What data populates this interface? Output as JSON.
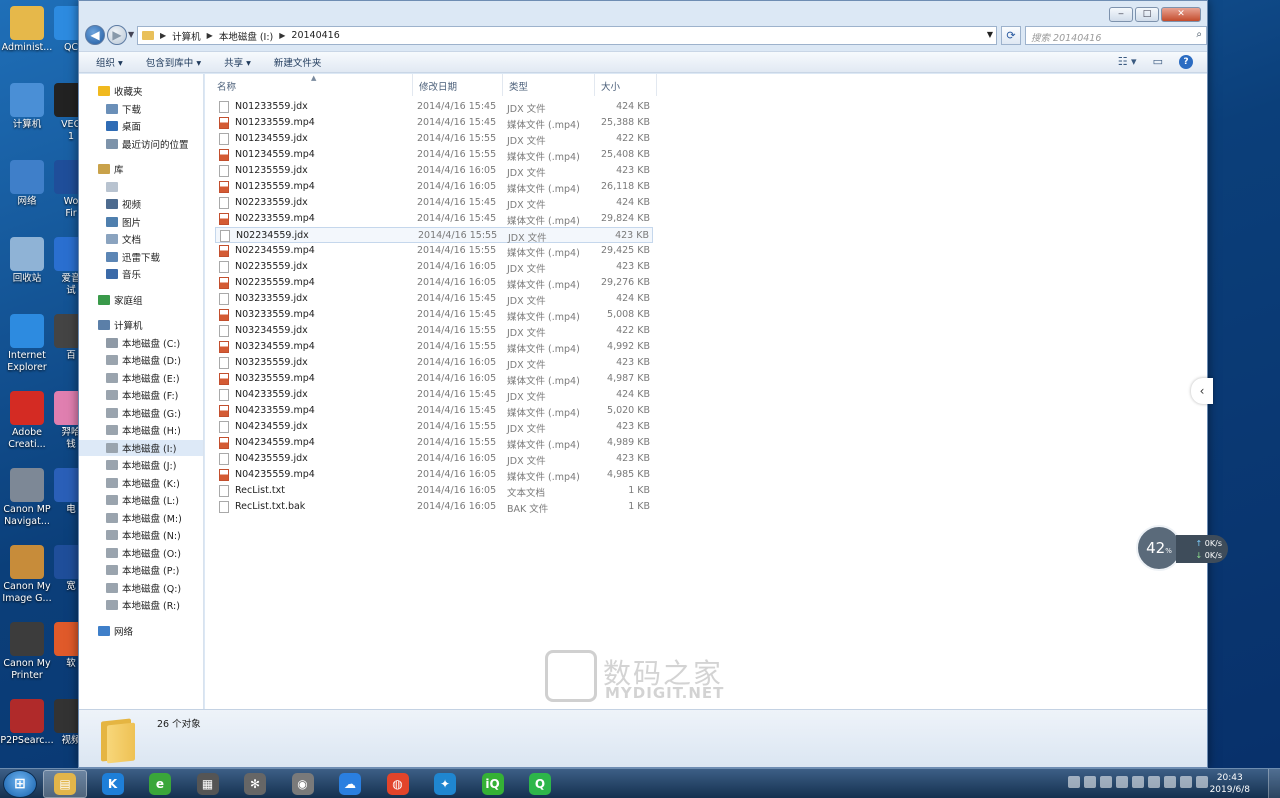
{
  "desktop": {
    "left_icons": [
      {
        "label": "Administ...",
        "icon": "user-folder-icon",
        "color": "#e6b84a"
      },
      {
        "label": "计算机",
        "icon": "computer-icon",
        "color": "#4a8fd6"
      },
      {
        "label": "网络",
        "icon": "network-icon",
        "color": "#3f7fc9"
      },
      {
        "label": "回收站",
        "icon": "recycle-bin-icon",
        "color": "#8fb3d6"
      },
      {
        "label": "Internet\nExplorer",
        "icon": "internet-explorer-icon",
        "color": "#2d8be0"
      },
      {
        "label": "Adobe\nCreati...",
        "icon": "adobe-creative-cloud-icon",
        "color": "#d42b23"
      },
      {
        "label": "Canon MP\nNavigat...",
        "icon": "canon-mp-navigator-icon",
        "color": "#7d8896"
      },
      {
        "label": "Canon My\nImage G...",
        "icon": "canon-my-image-garden-icon",
        "color": "#c78c3a"
      },
      {
        "label": "Canon My\nPrinter",
        "icon": "canon-my-printer-icon",
        "color": "#3c3c3c"
      },
      {
        "label": "P2PSearc...",
        "icon": "p2psearcher-icon",
        "color": "#b02a2a"
      }
    ],
    "right_icons": [
      {
        "label": "QC",
        "icon": "qq-icon",
        "color": "#2d8be0"
      },
      {
        "label": "VEG\n1",
        "icon": "vegas-icon",
        "color": "#222222"
      },
      {
        "label": "Wo\nFir",
        "icon": "word-firefox-icon",
        "color": "#1f4e9a"
      },
      {
        "label": "爱音\n试",
        "icon": "music-app-icon",
        "color": "#2a6fd0"
      },
      {
        "label": "百",
        "icon": "baidu-icon",
        "color": "#444444"
      },
      {
        "label": "羿哈\n钱",
        "icon": "app-icon",
        "color": "#e07fb0"
      },
      {
        "label": "电",
        "icon": "app-icon",
        "color": "#2a5fb8"
      },
      {
        "label": "宽",
        "icon": "broadband-icon",
        "color": "#1f4e9a"
      },
      {
        "label": "软",
        "icon": "software-icon",
        "color": "#e05a2a"
      },
      {
        "label": "视频",
        "icon": "video-app-icon",
        "color": "#333333"
      }
    ]
  },
  "window": {
    "controls": {
      "minimize": "‒",
      "maximize": "□",
      "close": "✕"
    },
    "address": {
      "segments": [
        "计算机",
        "本地磁盘 (I:)",
        "20140416"
      ]
    },
    "search_placeholder": "搜索 20140416",
    "toolbar": {
      "organize": "组织 ▾",
      "include_library": "包含到库中 ▾",
      "share": "共享 ▾",
      "new_folder": "新建文件夹"
    }
  },
  "navpane": [
    {
      "label": "收藏夹",
      "icon": "star-icon",
      "color": "#f0b91f",
      "level": 0,
      "sel": false
    },
    {
      "label": "下载",
      "icon": "download-folder-icon",
      "color": "#6a8fb8",
      "level": 1,
      "sel": false
    },
    {
      "label": "桌面",
      "icon": "desktop-icon",
      "color": "#2f6cb5",
      "level": 1,
      "sel": false
    },
    {
      "label": "最近访问的位置",
      "icon": "recent-places-icon",
      "color": "#7d93aa",
      "level": 1,
      "sel": false
    },
    {
      "label": "",
      "icon": "spacer",
      "color": "",
      "level": 0,
      "sel": false
    },
    {
      "label": "库",
      "icon": "library-icon",
      "color": "#c9a24a",
      "level": 0,
      "sel": false
    },
    {
      "label": "",
      "icon": "library-folder-icon",
      "color": "#b8c3d0",
      "level": 1,
      "sel": false
    },
    {
      "label": "视频",
      "icon": "videos-icon",
      "color": "#4d6b8f",
      "level": 1,
      "sel": false
    },
    {
      "label": "图片",
      "icon": "pictures-icon",
      "color": "#4f7fae",
      "level": 1,
      "sel": false
    },
    {
      "label": "文档",
      "icon": "documents-icon",
      "color": "#8aa3bf",
      "level": 1,
      "sel": false
    },
    {
      "label": "迅雷下载",
      "icon": "thunder-download-icon",
      "color": "#5c86b5",
      "level": 1,
      "sel": false
    },
    {
      "label": "音乐",
      "icon": "music-icon",
      "color": "#3b6aa8",
      "level": 1,
      "sel": false
    },
    {
      "label": "",
      "icon": "spacer",
      "color": "",
      "level": 0,
      "sel": false
    },
    {
      "label": "家庭组",
      "icon": "homegroup-icon",
      "color": "#3a9a4a",
      "level": 0,
      "sel": false
    },
    {
      "label": "",
      "icon": "spacer",
      "color": "",
      "level": 0,
      "sel": false
    },
    {
      "label": "计算机",
      "icon": "computer-icon",
      "color": "#5b7fa8",
      "level": 0,
      "sel": false
    },
    {
      "label": "本地磁盘 (C:)",
      "icon": "system-drive-icon",
      "color": "#8f9aa6",
      "level": 1,
      "sel": false
    },
    {
      "label": "本地磁盘 (D:)",
      "icon": "drive-icon",
      "color": "#9aa4ae",
      "level": 1,
      "sel": false
    },
    {
      "label": "本地磁盘 (E:)",
      "icon": "drive-icon",
      "color": "#9aa4ae",
      "level": 1,
      "sel": false
    },
    {
      "label": "本地磁盘 (F:)",
      "icon": "drive-icon",
      "color": "#9aa4ae",
      "level": 1,
      "sel": false
    },
    {
      "label": "本地磁盘 (G:)",
      "icon": "drive-icon",
      "color": "#9aa4ae",
      "level": 1,
      "sel": false
    },
    {
      "label": "本地磁盘 (H:)",
      "icon": "drive-icon",
      "color": "#9aa4ae",
      "level": 1,
      "sel": false
    },
    {
      "label": "本地磁盘 (I:)",
      "icon": "drive-icon",
      "color": "#9aa4ae",
      "level": 1,
      "sel": true
    },
    {
      "label": "本地磁盘 (J:)",
      "icon": "drive-icon",
      "color": "#9aa4ae",
      "level": 1,
      "sel": false
    },
    {
      "label": "本地磁盘 (K:)",
      "icon": "drive-icon",
      "color": "#9aa4ae",
      "level": 1,
      "sel": false
    },
    {
      "label": "本地磁盘 (L:)",
      "icon": "drive-icon",
      "color": "#9aa4ae",
      "level": 1,
      "sel": false
    },
    {
      "label": "本地磁盘 (M:)",
      "icon": "drive-icon",
      "color": "#9aa4ae",
      "level": 1,
      "sel": false
    },
    {
      "label": "本地磁盘 (N:)",
      "icon": "drive-icon",
      "color": "#9aa4ae",
      "level": 1,
      "sel": false
    },
    {
      "label": "本地磁盘 (O:)",
      "icon": "drive-icon",
      "color": "#9aa4ae",
      "level": 1,
      "sel": false
    },
    {
      "label": "本地磁盘 (P:)",
      "icon": "drive-icon",
      "color": "#9aa4ae",
      "level": 1,
      "sel": false
    },
    {
      "label": "本地磁盘 (Q:)",
      "icon": "drive-icon",
      "color": "#9aa4ae",
      "level": 1,
      "sel": false
    },
    {
      "label": "本地磁盘 (R:)",
      "icon": "drive-icon",
      "color": "#9aa4ae",
      "level": 1,
      "sel": false
    },
    {
      "label": "",
      "icon": "spacer",
      "color": "",
      "level": 0,
      "sel": false
    },
    {
      "label": "网络",
      "icon": "network-icon",
      "color": "#3f7fc9",
      "level": 0,
      "sel": false
    }
  ],
  "columns": {
    "name": "名称",
    "date": "修改日期",
    "type": "类型",
    "size": "大小"
  },
  "files": [
    {
      "name": "N01233559.jdx",
      "date": "2014/4/16 15:45",
      "type": "JDX 文件",
      "size": "424 KB",
      "kind": "doc"
    },
    {
      "name": "N01233559.mp4",
      "date": "2014/4/16 15:45",
      "type": "媒体文件 (.mp4)",
      "size": "25,388 KB",
      "kind": "mp4"
    },
    {
      "name": "N01234559.jdx",
      "date": "2014/4/16 15:55",
      "type": "JDX 文件",
      "size": "422 KB",
      "kind": "doc"
    },
    {
      "name": "N01234559.mp4",
      "date": "2014/4/16 15:55",
      "type": "媒体文件 (.mp4)",
      "size": "25,408 KB",
      "kind": "mp4"
    },
    {
      "name": "N01235559.jdx",
      "date": "2014/4/16 16:05",
      "type": "JDX 文件",
      "size": "423 KB",
      "kind": "doc"
    },
    {
      "name": "N01235559.mp4",
      "date": "2014/4/16 16:05",
      "type": "媒体文件 (.mp4)",
      "size": "26,118 KB",
      "kind": "mp4"
    },
    {
      "name": "N02233559.jdx",
      "date": "2014/4/16 15:45",
      "type": "JDX 文件",
      "size": "424 KB",
      "kind": "doc"
    },
    {
      "name": "N02233559.mp4",
      "date": "2014/4/16 15:45",
      "type": "媒体文件 (.mp4)",
      "size": "29,824 KB",
      "kind": "mp4"
    },
    {
      "name": "N02234559.jdx",
      "date": "2014/4/16 15:55",
      "type": "JDX 文件",
      "size": "423 KB",
      "kind": "doc",
      "hover": true
    },
    {
      "name": "N02234559.mp4",
      "date": "2014/4/16 15:55",
      "type": "媒体文件 (.mp4)",
      "size": "29,425 KB",
      "kind": "mp4"
    },
    {
      "name": "N02235559.jdx",
      "date": "2014/4/16 16:05",
      "type": "JDX 文件",
      "size": "423 KB",
      "kind": "doc"
    },
    {
      "name": "N02235559.mp4",
      "date": "2014/4/16 16:05",
      "type": "媒体文件 (.mp4)",
      "size": "29,276 KB",
      "kind": "mp4"
    },
    {
      "name": "N03233559.jdx",
      "date": "2014/4/16 15:45",
      "type": "JDX 文件",
      "size": "424 KB",
      "kind": "doc"
    },
    {
      "name": "N03233559.mp4",
      "date": "2014/4/16 15:45",
      "type": "媒体文件 (.mp4)",
      "size": "5,008 KB",
      "kind": "mp4"
    },
    {
      "name": "N03234559.jdx",
      "date": "2014/4/16 15:55",
      "type": "JDX 文件",
      "size": "422 KB",
      "kind": "doc"
    },
    {
      "name": "N03234559.mp4",
      "date": "2014/4/16 15:55",
      "type": "媒体文件 (.mp4)",
      "size": "4,992 KB",
      "kind": "mp4"
    },
    {
      "name": "N03235559.jdx",
      "date": "2014/4/16 16:05",
      "type": "JDX 文件",
      "size": "423 KB",
      "kind": "doc"
    },
    {
      "name": "N03235559.mp4",
      "date": "2014/4/16 16:05",
      "type": "媒体文件 (.mp4)",
      "size": "4,987 KB",
      "kind": "mp4"
    },
    {
      "name": "N04233559.jdx",
      "date": "2014/4/16 15:45",
      "type": "JDX 文件",
      "size": "424 KB",
      "kind": "doc"
    },
    {
      "name": "N04233559.mp4",
      "date": "2014/4/16 15:45",
      "type": "媒体文件 (.mp4)",
      "size": "5,020 KB",
      "kind": "mp4"
    },
    {
      "name": "N04234559.jdx",
      "date": "2014/4/16 15:55",
      "type": "JDX 文件",
      "size": "423 KB",
      "kind": "doc"
    },
    {
      "name": "N04234559.mp4",
      "date": "2014/4/16 15:55",
      "type": "媒体文件 (.mp4)",
      "size": "4,989 KB",
      "kind": "mp4"
    },
    {
      "name": "N04235559.jdx",
      "date": "2014/4/16 16:05",
      "type": "JDX 文件",
      "size": "423 KB",
      "kind": "doc"
    },
    {
      "name": "N04235559.mp4",
      "date": "2014/4/16 16:05",
      "type": "媒体文件 (.mp4)",
      "size": "4,985 KB",
      "kind": "mp4"
    },
    {
      "name": "RecList.txt",
      "date": "2014/4/16 16:05",
      "type": "文本文档",
      "size": "1 KB",
      "kind": "doc"
    },
    {
      "name": "RecList.txt.bak",
      "date": "2014/4/16 16:05",
      "type": "BAK 文件",
      "size": "1 KB",
      "kind": "doc"
    }
  ],
  "status": {
    "count_text": "26 个对象"
  },
  "watermark": {
    "cn": "数码之家",
    "en": "MYDIGIT.NET"
  },
  "net_meter": {
    "percent": "42",
    "unit": "%",
    "up": "0K/s",
    "down": "0K/s"
  },
  "taskbar": {
    "start_glyph": "⊞",
    "apps": [
      {
        "name": "explorer-taskbar-icon",
        "glyph": "▤",
        "color": "#e2b54a",
        "active": true
      },
      {
        "name": "kugou-taskbar-icon",
        "glyph": "K",
        "color": "#1e7fd8",
        "active": false
      },
      {
        "name": "browser-taskbar-icon",
        "glyph": "e",
        "color": "#3aa63a",
        "active": false
      },
      {
        "name": "video-editor-taskbar-icon",
        "glyph": "▦",
        "color": "#555555",
        "active": false
      },
      {
        "name": "film-reel-taskbar-icon",
        "glyph": "✻",
        "color": "#666666",
        "active": false
      },
      {
        "name": "photo-app-taskbar-icon",
        "glyph": "◉",
        "color": "#7a7a7a",
        "active": false
      },
      {
        "name": "baidu-netdisk-taskbar-icon",
        "glyph": "☁",
        "color": "#2a7fe0",
        "active": false
      },
      {
        "name": "weibo-taskbar-icon",
        "glyph": "◍",
        "color": "#e2442a",
        "active": false
      },
      {
        "name": "network-app-taskbar-icon",
        "glyph": "✦",
        "color": "#1f86d0",
        "active": false
      },
      {
        "name": "iqiyi-taskbar-icon",
        "glyph": "iQ",
        "color": "#35b135",
        "active": false
      },
      {
        "name": "qvod-taskbar-icon",
        "glyph": "Q",
        "color": "#2db64a",
        "active": false
      }
    ],
    "time": "20:43",
    "date": "2019/6/8"
  }
}
